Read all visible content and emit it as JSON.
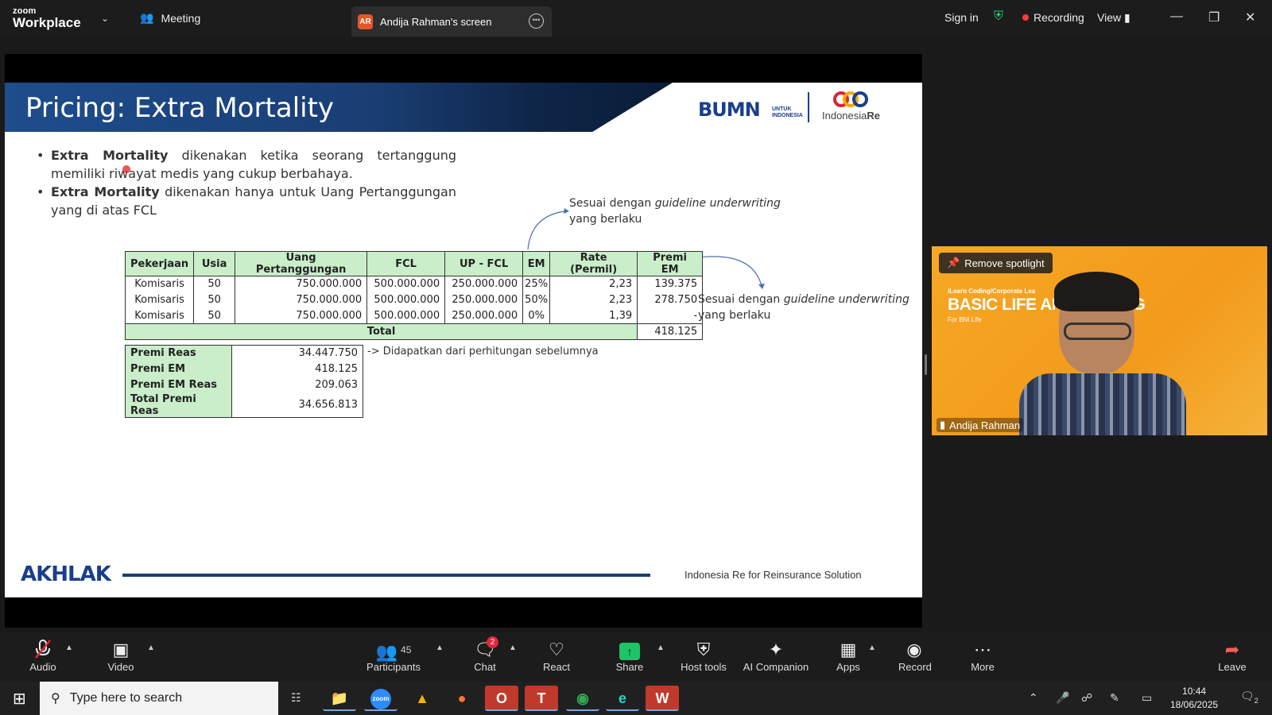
{
  "titlebar": {
    "logo_top": "zoom",
    "logo_bottom": "Workplace",
    "meeting_label": "Meeting",
    "share_badge": "AR",
    "share_title": "Andija Rahman's screen",
    "sign_in": "Sign in",
    "recording": "Recording",
    "view": "View"
  },
  "slide": {
    "title": "Pricing: Extra Mortality",
    "logo_bumn": "BUMN",
    "logo_bumn_sub1": "UNTUK",
    "logo_bumn_sub2": "INDONESIA",
    "logo_ire_a": "Indonesia",
    "logo_ire_b": "Re",
    "bullet1_bold": "Extra Mortality",
    "bullet1_rest": " dikenakan ketika seorang tertanggung memiliki riwayat medis yang cukup berbahaya.",
    "bullet2_bold": "Extra Mortality",
    "bullet2_rest": " dikenakan hanya untuk Uang Pertanggungan yang di atas FCL",
    "annotation1_a": "Sesuai dengan ",
    "annotation1_i": "guideline underwriting",
    "annotation1_b": "yang berlaku",
    "annotation2_a": "Sesuai dengan ",
    "annotation2_i": "guideline underwriting",
    "annotation2_b": "yang berlaku",
    "table_headers": [
      "Pekerjaan",
      "Usia",
      "Uang Pertanggungan",
      "FCL",
      "UP - FCL",
      "EM",
      "Rate (Permil)",
      "Premi EM"
    ],
    "table_rows": [
      [
        "Komisaris",
        "50",
        "750.000.000",
        "500.000.000",
        "250.000.000",
        "25%",
        "2,23",
        "139.375"
      ],
      [
        "Komisaris",
        "50",
        "750.000.000",
        "500.000.000",
        "250.000.000",
        "50%",
        "2,23",
        "278.750"
      ],
      [
        "Komisaris",
        "50",
        "750.000.000",
        "500.000.000",
        "250.000.000",
        "0%",
        "1,39",
        "-"
      ]
    ],
    "total_label": "Total",
    "total_value": "418.125",
    "summary": [
      {
        "label": "Premi Reas",
        "value": "34.447.750"
      },
      {
        "label": "Premi EM",
        "value": "418.125"
      },
      {
        "label": "Premi EM Reas",
        "value": "209.063"
      },
      {
        "label": "Total Premi Reas",
        "value": "34.656.813"
      }
    ],
    "summary_note": "-> Didapatkan dari perhitungan sebelumnya",
    "footer_logo": "AKHLAK",
    "footer_text": "Indonesia Re for Reinsurance Solution"
  },
  "video": {
    "remove_spotlight": "Remove spotlight",
    "slide_line1": "iLearn Coding/Corporate Lea",
    "slide_line2": "BASIC LIFE AN        TRAINING",
    "slide_line3": "For BNI Life",
    "participant_name": "Andija Rahman"
  },
  "toolbar": {
    "audio": "Audio",
    "video": "Video",
    "participants": "Participants",
    "participants_count": "45",
    "chat": "Chat",
    "chat_badge": "2",
    "react": "React",
    "share": "Share",
    "host_tools": "Host tools",
    "ai_companion": "AI Companion",
    "apps": "Apps",
    "record": "Record",
    "more": "More",
    "leave": "Leave"
  },
  "taskbar": {
    "search_placeholder": "Type here to search",
    "time": "10:44",
    "date": "18/06/2025",
    "notif_count": "2"
  }
}
